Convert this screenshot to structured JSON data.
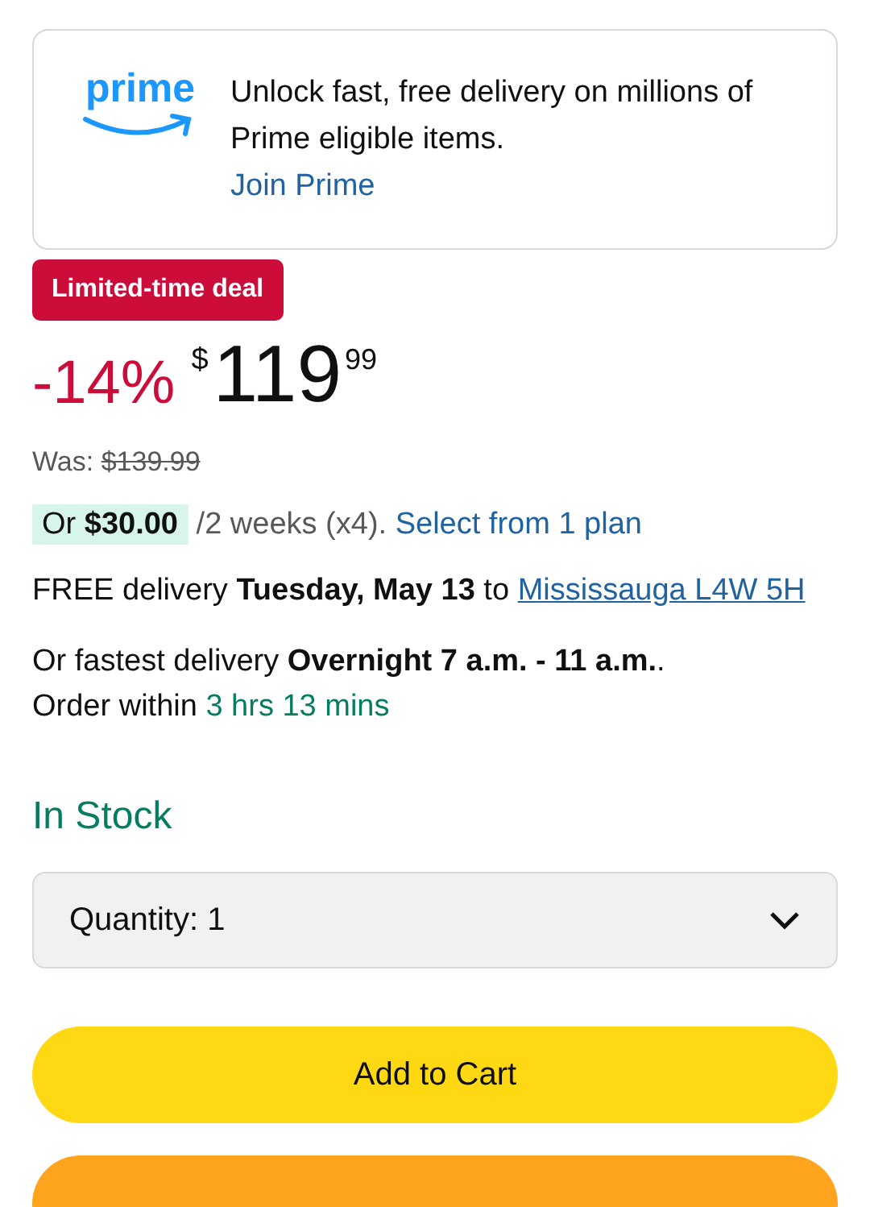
{
  "prime_banner": {
    "logo": "prime",
    "message": "Unlock fast, free delivery on millions of Prime eligible items.",
    "link": "Join Prime"
  },
  "deal_badge": "Limited-time deal",
  "price": {
    "discount": "-14%",
    "currency": "$",
    "whole": "119",
    "fraction": "99",
    "was_label": "Was:",
    "was_price": "$139.99"
  },
  "installment": {
    "amount": "Or **$30.00**",
    "terms": "/2 weeks (x4).",
    "link": "Select from 1 plan"
  },
  "delivery": {
    "text": "FREE delivery **Tuesday, May 13** to",
    "location": "Mississauga L4W 5H"
  },
  "fastest": {
    "text": "Or fastest delivery **Overnight 7 a.m. - 11 a.m.**.",
    "order_within": "Order within",
    "countdown": "3 hrs 13 mins"
  },
  "stock": "In Stock",
  "quantity": {
    "label": "Quantity:",
    "value": "1"
  },
  "buttons": [
    {
      "kind": "cart",
      "label": "Add to Cart"
    },
    {
      "kind": "buy"
    }
  ]
}
